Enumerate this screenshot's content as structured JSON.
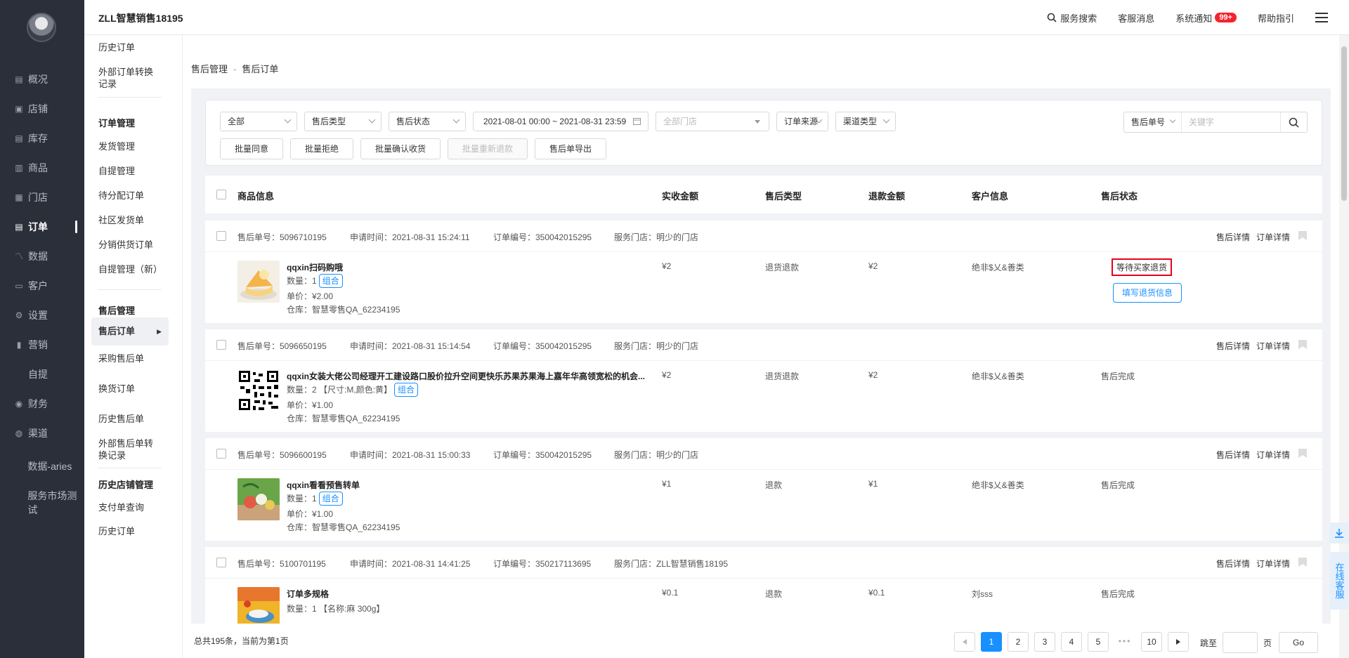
{
  "header": {
    "shop_name": "ZLL智慧销售18195",
    "search_label": "服务搜索",
    "service_messages": "客服消息",
    "system_notice": "系统通知",
    "notice_badge": "99+",
    "help": "帮助指引"
  },
  "nav": {
    "items": [
      {
        "label": "概况",
        "icon": "chart-icon"
      },
      {
        "label": "店铺",
        "icon": "store-icon"
      },
      {
        "label": "库存",
        "icon": "inventory-icon"
      },
      {
        "label": "商品",
        "icon": "goods-icon"
      },
      {
        "label": "门店",
        "icon": "shop-icon"
      },
      {
        "label": "订单",
        "icon": "order-icon"
      },
      {
        "label": "数据",
        "icon": "data-icon"
      },
      {
        "label": "客户",
        "icon": "customer-icon"
      },
      {
        "label": "设置",
        "icon": "settings-icon"
      },
      {
        "label": "营销",
        "icon": "marketing-icon"
      },
      {
        "label": "自提",
        "icon": ""
      },
      {
        "label": "财务",
        "icon": "finance-icon"
      },
      {
        "label": "渠道",
        "icon": "channel-icon"
      },
      {
        "label": "数据-aries",
        "icon": ""
      },
      {
        "label": "服务市场测试",
        "icon": ""
      }
    ],
    "active": "订单"
  },
  "subnav": {
    "history_orders_top": "历史订单",
    "external_order_records": "外部订单转换记录",
    "group_order_mgmt": "订单管理",
    "shipping_mgmt": "发货管理",
    "pickup_mgmt": "自提管理",
    "pending_assign": "待分配订单",
    "community_ship": "社区发货单",
    "distribution_supply": "分销供货订单",
    "pickup_mgmt_new": "自提管理（新）",
    "group_aftersale": "售后管理",
    "aftersale_orders": "售后订单",
    "purchase_aftersale": "采购售后单",
    "exchange_orders": "换货订单",
    "history_aftersale": "历史售后单",
    "external_aftersale_records": "外部售后单转换记录",
    "group_history_store": "历史店铺管理",
    "payment_query": "支付单查询",
    "history_orders_bottom": "历史订单"
  },
  "breadcrumb": {
    "parent": "售后管理",
    "sep": "-",
    "current": "售后订单"
  },
  "filters": {
    "all": "全部",
    "aftersale_type": "售后类型",
    "aftersale_status": "售后状态",
    "date_range": "2021-08-01 00:00 ~ 2021-08-31 23:59",
    "all_stores": "全部门店",
    "order_source": "订单来源",
    "channel_type": "渠道类型",
    "search_type": "售后单号",
    "keyword_placeholder": "关键字"
  },
  "batch_buttons": {
    "agree": "批量同意",
    "reject": "批量拒绝",
    "confirm_receipt": "批量确认收货",
    "re_refund": "批量重新退款",
    "export": "售后单导出"
  },
  "table_headers": {
    "product": "商品信息",
    "received": "实收金额",
    "type": "售后类型",
    "refund": "退款金额",
    "customer": "客户信息",
    "status": "售后状态"
  },
  "row_actions": {
    "aftersale_detail": "售后详情",
    "order_detail": "订单详情",
    "fill_return": "填写退货信息"
  },
  "orders": [
    {
      "aftersale_no": "售后单号：5096710195",
      "apply_time": "申请时间：2021-08-31 15:24:11",
      "order_no": "订单编号：350042015295",
      "store": "服务门店：明少的门店",
      "product_name": "qqxin扫码购哦",
      "qty": "数量：1",
      "spec": "",
      "tag": "组合",
      "price": "单价：¥2.00",
      "warehouse": "仓库：智慧零售QA_62234195",
      "received": "¥2",
      "type": "退货退款",
      "refund": "¥2",
      "customer": "绝非$乂&善类",
      "status": "等待买家退货"
    },
    {
      "aftersale_no": "售后单号：5096650195",
      "apply_time": "申请时间：2021-08-31 15:14:54",
      "order_no": "订单编号：350042015295",
      "store": "服务门店：明少的门店",
      "product_name": "qqxin女装大佬公司经理开工建设路口股价拉升空间更快乐苏果苏果海上嘉年华高领宽松的机会...",
      "qty": "数量：2",
      "spec": "【尺寸:M,颜色:黄】",
      "tag": "组合",
      "price": "单价：¥1.00",
      "warehouse": "仓库：智慧零售QA_62234195",
      "received": "¥2",
      "type": "退货退款",
      "refund": "¥2",
      "customer": "绝非$乂&善类",
      "status": "售后完成"
    },
    {
      "aftersale_no": "售后单号：5096600195",
      "apply_time": "申请时间：2021-08-31 15:00:33",
      "order_no": "订单编号：350042015295",
      "store": "服务门店：明少的门店",
      "product_name": "qqxin看看预售转单",
      "qty": "数量：1",
      "spec": "",
      "tag": "组合",
      "price": "单价：¥1.00",
      "warehouse": "仓库：智慧零售QA_62234195",
      "received": "¥1",
      "type": "退款",
      "refund": "¥1",
      "customer": "绝非$乂&善类",
      "status": "售后完成"
    },
    {
      "aftersale_no": "售后单号：5100701195",
      "apply_time": "申请时间：2021-08-31 14:41:25",
      "order_no": "订单编号：350217113695",
      "store": "服务门店：ZLL智慧销售18195",
      "product_name": "订单多规格",
      "qty": "数量：1",
      "spec": "【名称:麻 300g】",
      "tag": "",
      "price": "",
      "warehouse": "",
      "received": "¥0.1",
      "type": "退款",
      "refund": "¥0.1",
      "customer": "刘sss",
      "status": "售后完成"
    }
  ],
  "pagination": {
    "total": "总共195条，当前为第1页",
    "pages": [
      "1",
      "2",
      "3",
      "4",
      "5",
      "•••",
      "10"
    ],
    "current": "1",
    "jump_to": "跳至",
    "page_unit": "页",
    "go": "Go"
  },
  "floating": {
    "online_service": "在线客服"
  }
}
